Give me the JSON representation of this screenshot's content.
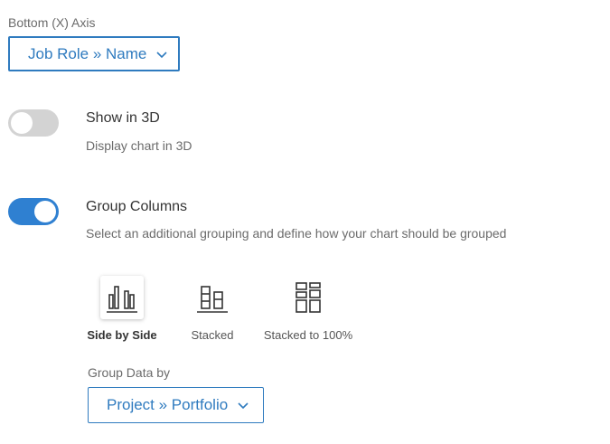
{
  "x_axis": {
    "label": "Bottom (X) Axis",
    "value": "Job Role » Name",
    "icon": "chevron-down-icon"
  },
  "show_3d": {
    "enabled": false,
    "title": "Show in 3D",
    "description": "Display chart in 3D"
  },
  "group_columns": {
    "enabled": true,
    "title": "Group Columns",
    "description": "Select an additional grouping and define how your chart should be grouped",
    "options": [
      {
        "label": "Side by Side",
        "icon": "side-by-side-bars-icon",
        "selected": true
      },
      {
        "label": "Stacked",
        "icon": "stacked-bars-icon",
        "selected": false
      },
      {
        "label": "Stacked to 100%",
        "icon": "stacked-100-bars-icon",
        "selected": false
      }
    ]
  },
  "group_data_by": {
    "label": "Group Data by",
    "value": "Project » Portfolio",
    "icon": "chevron-down-icon"
  },
  "colors": {
    "accent": "#2f7bbf",
    "toggle_on": "#2f80d1",
    "toggle_off": "#d3d3d3"
  }
}
